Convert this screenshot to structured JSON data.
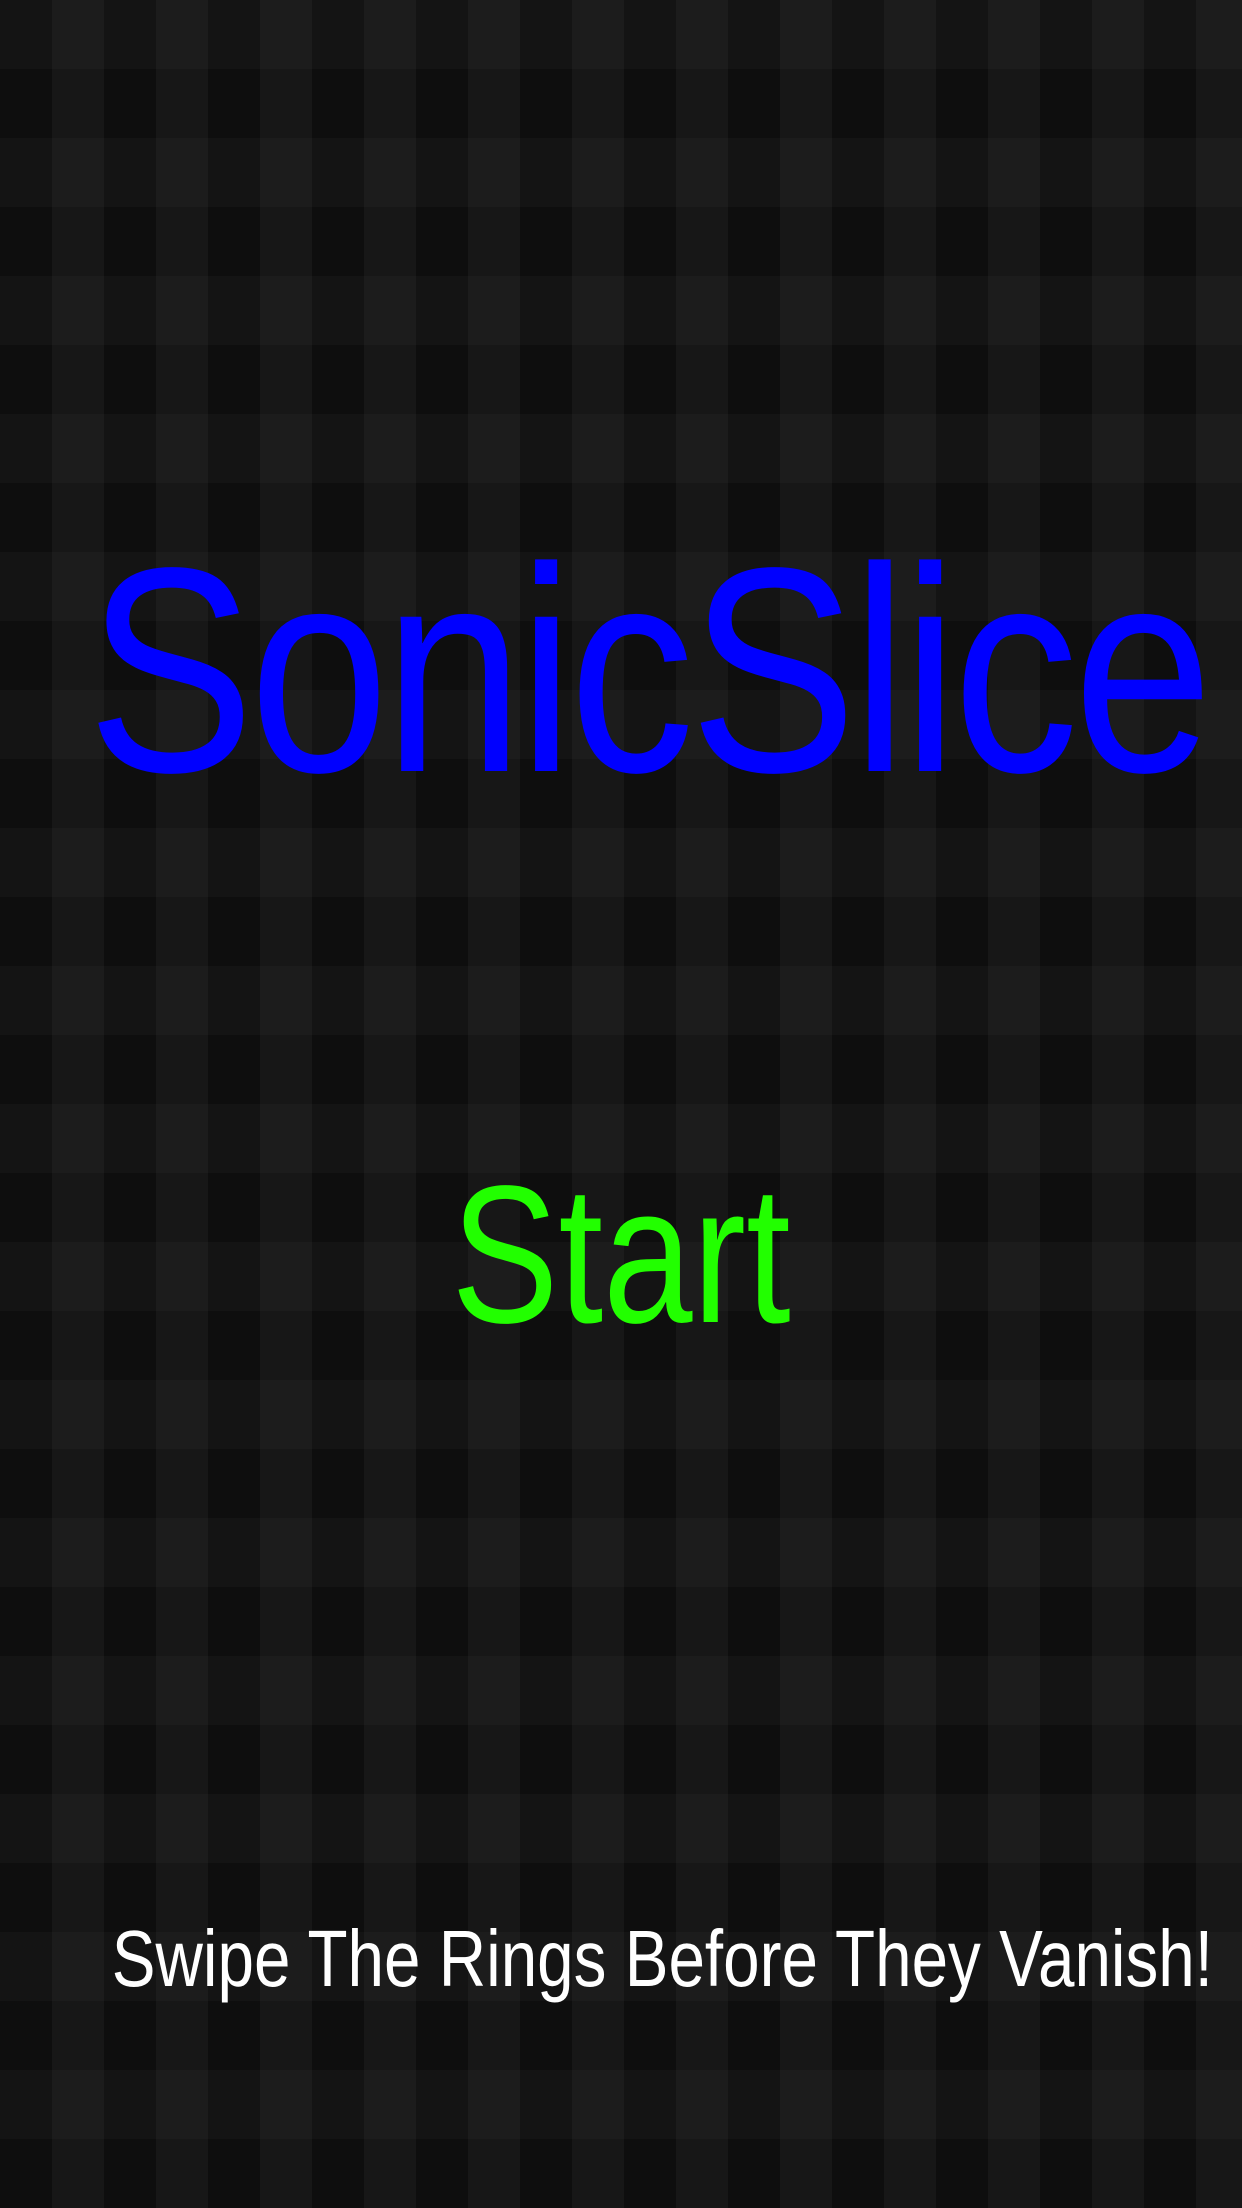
{
  "game": {
    "title": "SonicSlice",
    "start_label": "Start",
    "tagline": "Swipe The Rings Before They Vanish!"
  },
  "colors": {
    "title": "#0000ff",
    "start": "#22ff00",
    "tagline": "#ffffff",
    "background": "#161616"
  }
}
